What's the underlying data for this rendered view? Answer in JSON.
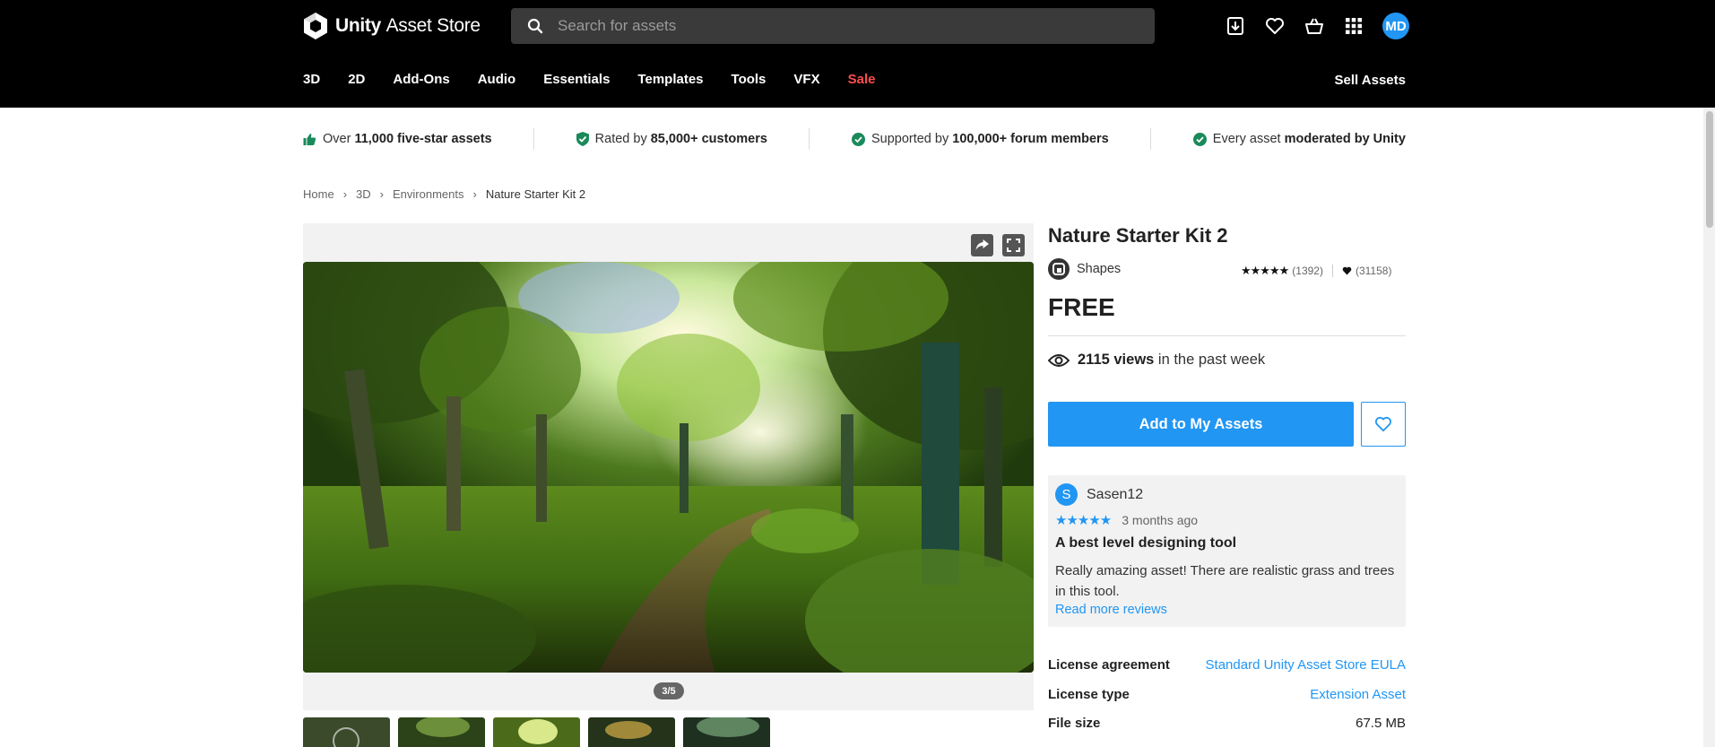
{
  "header": {
    "brand_bold": "Unity",
    "brand_light": "Asset Store",
    "search_placeholder": "Search for assets",
    "avatar_initials": "MD",
    "icons": [
      "download-icon",
      "heart-icon",
      "basket-icon",
      "grid-icon"
    ],
    "categories": [
      "3D",
      "2D",
      "Add-Ons",
      "Audio",
      "Essentials",
      "Templates",
      "Tools",
      "VFX",
      "Sale"
    ],
    "sell_label": "Sell Assets"
  },
  "trust": [
    {
      "pre": "Over ",
      "bold": "11,000 five-star assets",
      "post": ""
    },
    {
      "pre": "Rated by ",
      "bold": "85,000+ customers",
      "post": ""
    },
    {
      "pre": "Supported by ",
      "bold": "100,000+ forum members",
      "post": ""
    },
    {
      "pre": "Every asset ",
      "bold": "moderated by Unity",
      "post": ""
    }
  ],
  "breadcrumb": [
    "Home",
    "3D",
    "Environments",
    "Nature Starter Kit 2"
  ],
  "gallery": {
    "counter": "3/5"
  },
  "product": {
    "title": "Nature Starter Kit 2",
    "publisher": "Shapes",
    "stars": "★★★★★",
    "rating_count": "(1392)",
    "fav_count": "(31158)",
    "price": "FREE",
    "views_bold": "2115 views",
    "views_rest": " in the past week",
    "add_label": "Add to My Assets"
  },
  "review": {
    "avatar": "S",
    "user": "Sasen12",
    "stars": "★★★★★",
    "time": "3 months ago",
    "title": "A best level designing tool",
    "body": "Really amazing asset! There are realistic grass and trees in this tool.",
    "more": "Read more reviews"
  },
  "details": [
    {
      "key": "License agreement",
      "value": "Standard Unity Asset Store EULA",
      "link": true
    },
    {
      "key": "License type",
      "value": "Extension Asset",
      "link": true
    },
    {
      "key": "File size",
      "value": "67.5 MB",
      "link": false
    }
  ],
  "colors": {
    "accent": "#2196f3",
    "sale": "#ff4d4d",
    "header_bg": "#000000",
    "trust_check": "#1a8a5a"
  }
}
